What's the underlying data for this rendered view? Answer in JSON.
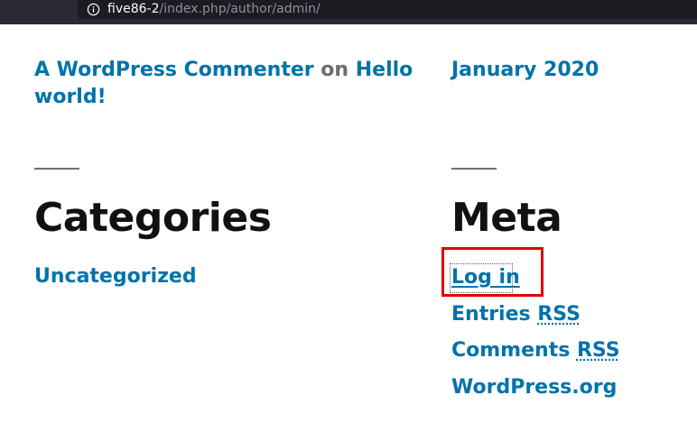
{
  "browser": {
    "url_host": "five86-2",
    "url_path": "/index.php/author/admin/",
    "info_icon": "info-circle-icon"
  },
  "recent_comments": {
    "author": "A WordPress Commenter",
    "on_word": "on",
    "post": "Hello world!"
  },
  "archives": {
    "item": "January 2020"
  },
  "categories": {
    "title": "Categories",
    "items": [
      "Uncategorized"
    ]
  },
  "meta": {
    "title": "Meta",
    "login": "Log in",
    "entries_prefix": "Entries",
    "entries_abbr": "RSS",
    "comments_prefix": "Comments",
    "comments_abbr": "RSS",
    "wordpress": "WordPress.org"
  },
  "colors": {
    "link": "#0073aa",
    "heading": "#111111",
    "highlight": "#e10000"
  }
}
